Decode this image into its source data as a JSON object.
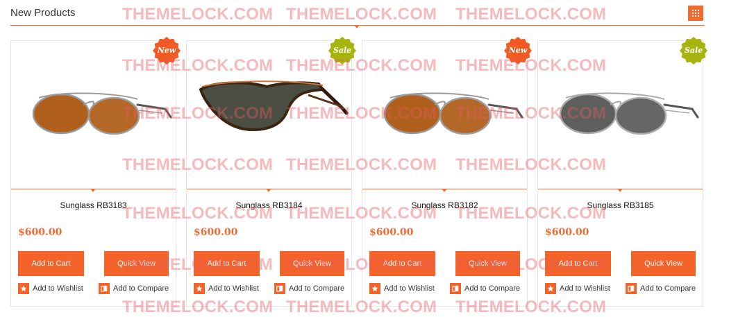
{
  "header": {
    "title": "New Products",
    "grid_icon": "grid-view-icon"
  },
  "colors": {
    "accent": "#f26a2e",
    "new_badge": "#f15a22",
    "sale_badge": "#a8b40d",
    "watermark": "#e45a64"
  },
  "products": [
    {
      "name": "Sunglass RB3183",
      "price": "$600.00",
      "badge": "New",
      "badge_type": "new",
      "lens_color": "#b0601c",
      "frame_color": "#9a9a9a",
      "style": "aviator-gradient"
    },
    {
      "name": "Sunglass RB3184",
      "price": "$600.00",
      "badge": "Sale",
      "badge_type": "sale",
      "lens_color": "#4b4e43",
      "frame_color": "#5b3417",
      "style": "shield-dark"
    },
    {
      "name": "Sunglass RB3182",
      "price": "$600.00",
      "badge": "New",
      "badge_type": "new",
      "lens_color": "#b0601c",
      "frame_color": "#9a9a9a",
      "style": "aviator-gradient"
    },
    {
      "name": "Sunglass RB3185",
      "price": "$600.00",
      "badge": "Sale",
      "badge_type": "sale",
      "lens_color": "#5d5f5c",
      "frame_color": "#a9a9a9",
      "style": "aviator-grey"
    }
  ],
  "actions": {
    "add_to_cart": "Add to Cart",
    "quick_view": "Quick View",
    "add_to_wishlist": "Add to Wishlist",
    "add_to_compare": "Add to Compare"
  },
  "watermark_text": "THEMELOCK.COM"
}
